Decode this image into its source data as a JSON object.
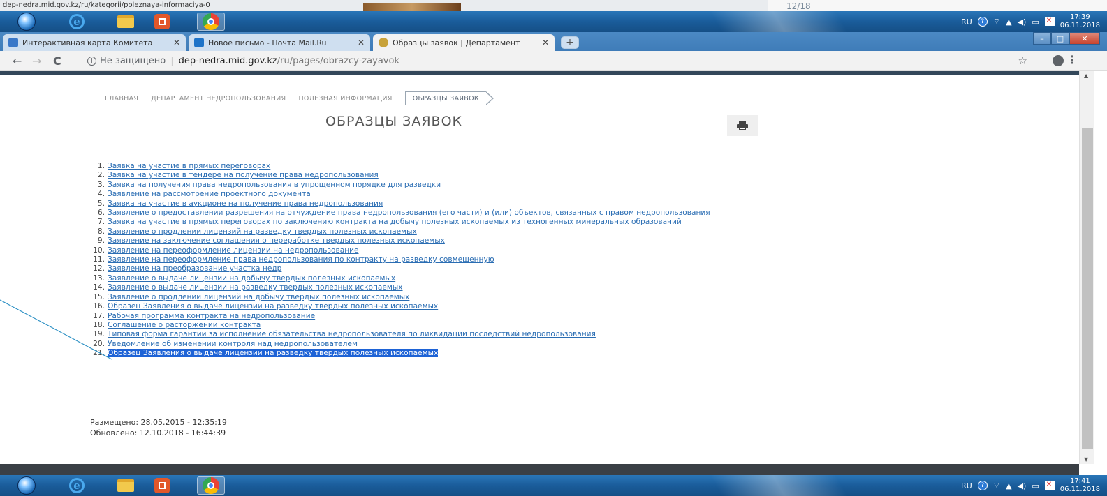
{
  "top_status": {
    "url": "dep-nedra.mid.gov.kz/ru/kategorii/poleznaya-informaciya-0",
    "counter": "12/18"
  },
  "taskbar_top": {
    "lang": "RU",
    "time": "17:39",
    "date": "06.11.2018"
  },
  "taskbar_bottom": {
    "lang": "RU",
    "time": "17:41",
    "date": "06.11.2018"
  },
  "tabs": [
    {
      "label": "Интерактивная карта Комитета",
      "close": "✕"
    },
    {
      "label": "Новое письмо - Почта Mail.Ru",
      "close": "✕"
    },
    {
      "label": "Образцы заявок | Департамент",
      "close": "✕"
    }
  ],
  "new_tab_label": "+",
  "window_controls": {
    "minimize": "–",
    "maximize": "□",
    "close": "✕"
  },
  "address": {
    "back": "←",
    "forward": "→",
    "reload": "C",
    "security": "Не защищено",
    "host": "dep-nedra.mid.gov.kz",
    "path": "/ru/pages/obrazcy-zayavok",
    "star": "☆",
    "menu": "⋮"
  },
  "breadcrumb": [
    "ГЛАВНАЯ",
    "ДЕПАРТАМЕНТ НЕДРОПОЛЬЗОВАНИЯ",
    "ПОЛЕЗНАЯ ИНФОРМАЦИЯ",
    "ОБРАЗЦЫ ЗАЯВОК"
  ],
  "page_title": "ОБРАЗЦЫ ЗАЯВОК",
  "documents": [
    {
      "num": "1.",
      "text": "Заявка на участие в прямых переговорах"
    },
    {
      "num": "2.",
      "text": "Заявка на участие в тендере на получение права недропользования"
    },
    {
      "num": "3.",
      "text": "Заявка на получения права недропользования в упрощенном порядке для разведки"
    },
    {
      "num": "4.",
      "text": "Заявление на рассмотрение проектного документа"
    },
    {
      "num": "5.",
      "text": "Заявка на участие в аукционе на получение права недропользования"
    },
    {
      "num": "6.",
      "text": "Заявление о предоставлении разрешения на отчуждение права недропользования (его части) и (или) объектов, связанных с правом недропользования"
    },
    {
      "num": "7.",
      "text": "Заявка на участие в прямых переговорах по заключению контракта на добычу полезных ископаемых из техногенных минеральных образований"
    },
    {
      "num": "8.",
      "text": "Заявление  о продлении лицензий на разведку твердых полезных ископаемых"
    },
    {
      "num": "9.",
      "text": "Заявление на заключение соглашения о переработке твердых полезных ископаемых"
    },
    {
      "num": "10.",
      "text": "Заявление на переоформление лицензии на недропользование"
    },
    {
      "num": "11.",
      "text": "Заявление на переоформление права недропользования по контракту на разведку совмещенную"
    },
    {
      "num": "12.",
      "text": "Заявление на преобразование участка недр"
    },
    {
      "num": "13.",
      "text": "Заявление о выдаче лицензии на добычу твердых полезных ископаемых"
    },
    {
      "num": "14.",
      "text": "Заявление о выдаче лицензии на разведку твердых полезных ископаемых"
    },
    {
      "num": "15.",
      "text": "Заявление о продлении лицензий на добычу твердых полезных ископаемых"
    },
    {
      "num": "16.",
      "text": "Образец Заявления о выдаче лицензии на разведку твердых полезных ископаемых"
    },
    {
      "num": "17.",
      "text": "Рабочая программа контракта на недропользование"
    },
    {
      "num": "18.",
      "text": "Соглашение о расторжении контракта"
    },
    {
      "num": "19.",
      "text": "Типовая форма гарантии за исполнение обязательства недропользователя по ликвидации последствий недропользования"
    },
    {
      "num": "20.",
      "text": "Уведомление  об изменении контроля над недропользователем"
    },
    {
      "num": "21.",
      "text": "Образец Заявления о выдаче лицензии на разведку твердых полезных ископаемых",
      "selected": true
    }
  ],
  "meta": {
    "posted": "Размещено: 28.05.2015 - 12:35:19",
    "updated": "Обновлено: 12.10.2018 - 16:44:39"
  },
  "colors": {
    "link": "#2a6db3",
    "selection": "#1e63d6",
    "taskbar": "#1a5c9a",
    "callout_line": "#2a8fc4"
  }
}
